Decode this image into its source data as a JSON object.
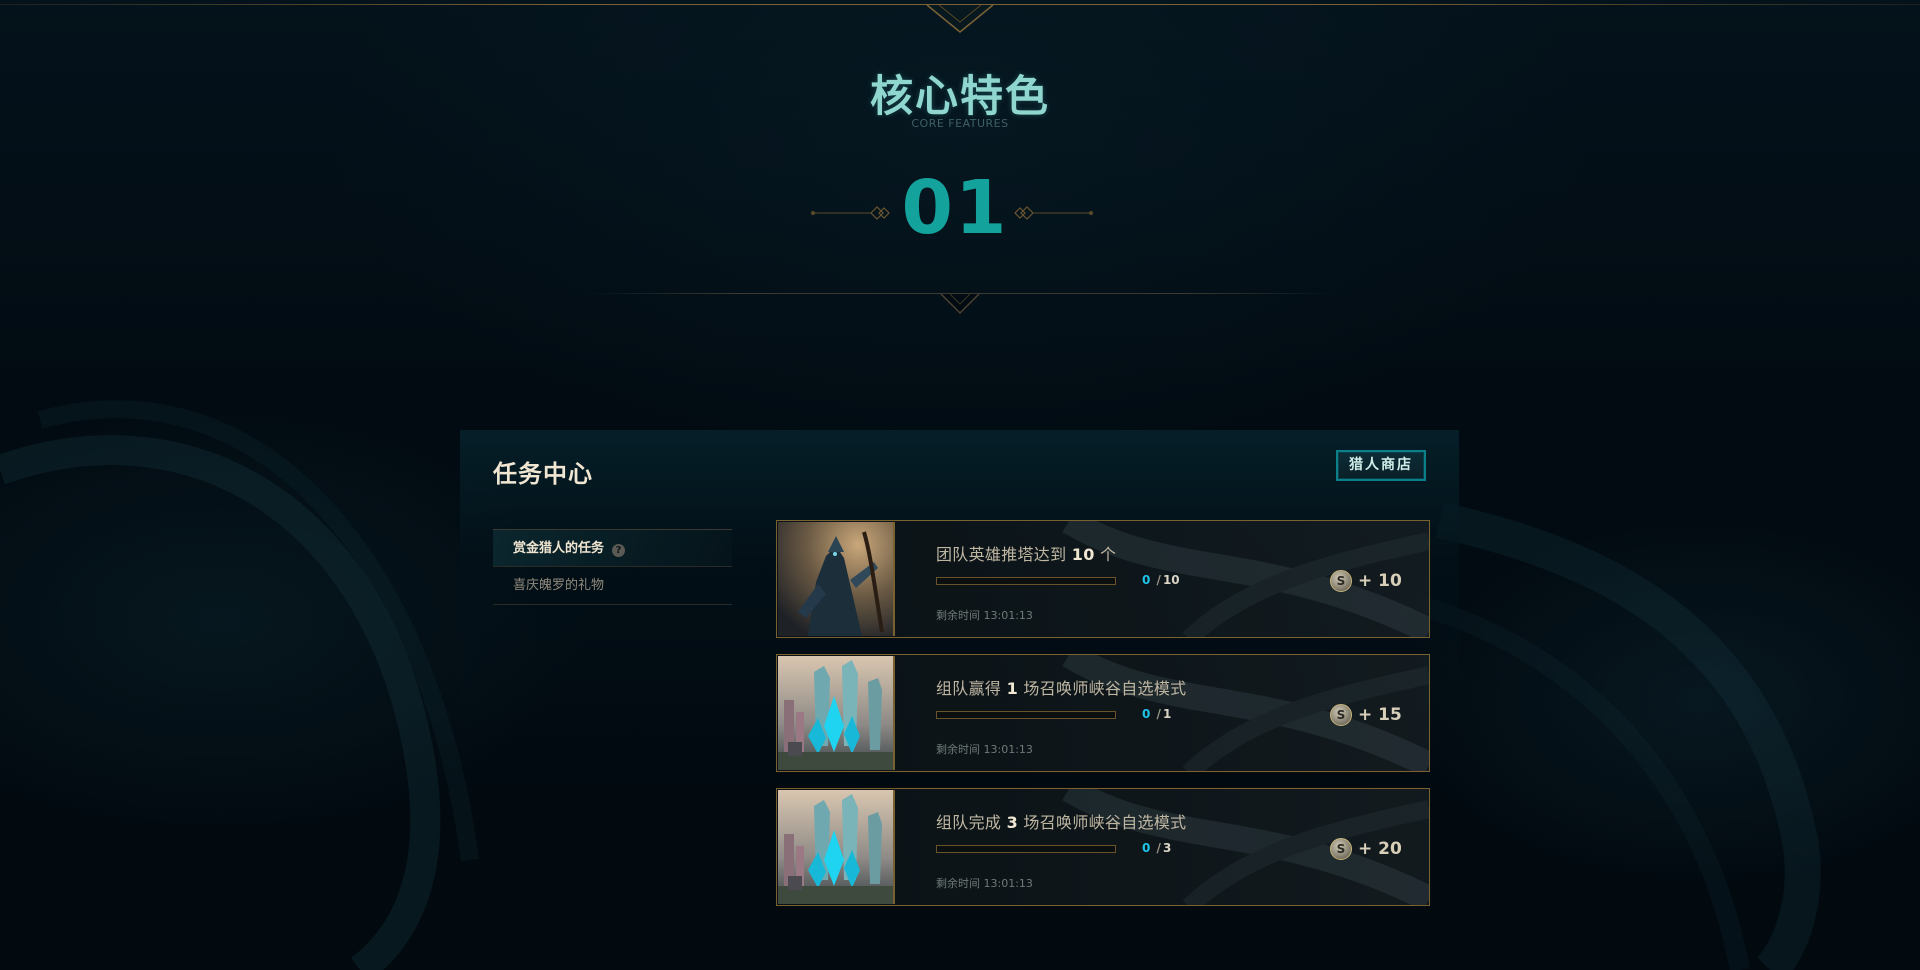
{
  "section": {
    "heading": "核心特色",
    "subheading": "CORE FEATURES",
    "number": "01"
  },
  "panel": {
    "title": "任务中心",
    "shop_button": "猎人商店",
    "nav": [
      {
        "label": "赏金猎人的任务",
        "help_icon": "?"
      },
      {
        "label": "喜庆魄罗的礼物"
      }
    ]
  },
  "tasks": [
    {
      "title_pre": "团队英雄推塔达到 ",
      "title_num": "10",
      "title_post": " 个",
      "progress_current": "0",
      "progress_sep": "/",
      "progress_total": "10",
      "progress_fraction": 0,
      "time": "剩余时间 13:01:13",
      "reward_coin": "S",
      "reward": "+ 10",
      "thumb_icon": "dark-warrior-portrait"
    },
    {
      "title_pre": "组队赢得 ",
      "title_num": "1",
      "title_post": " 场召唤师峡谷自选模式",
      "progress_current": "0",
      "progress_sep": "/",
      "progress_total": "1",
      "progress_fraction": 0,
      "time": "剩余时间 13:01:13",
      "reward_coin": "S",
      "reward": "+ 15",
      "thumb_icon": "crystal-nexus-scene"
    },
    {
      "title_pre": "组队完成 ",
      "title_num": "3",
      "title_post": " 场召唤师峡谷自选模式",
      "progress_current": "0",
      "progress_sep": "/",
      "progress_total": "3",
      "progress_fraction": 0,
      "time": "剩余时间 13:01:13",
      "reward_coin": "S",
      "reward": "+ 20",
      "thumb_icon": "crystal-nexus-scene"
    }
  ],
  "colors": {
    "accent_teal": "#14a39c",
    "gold_border": "#7a6130",
    "progress_current": "#1ec4e8",
    "background": "#020b12"
  }
}
